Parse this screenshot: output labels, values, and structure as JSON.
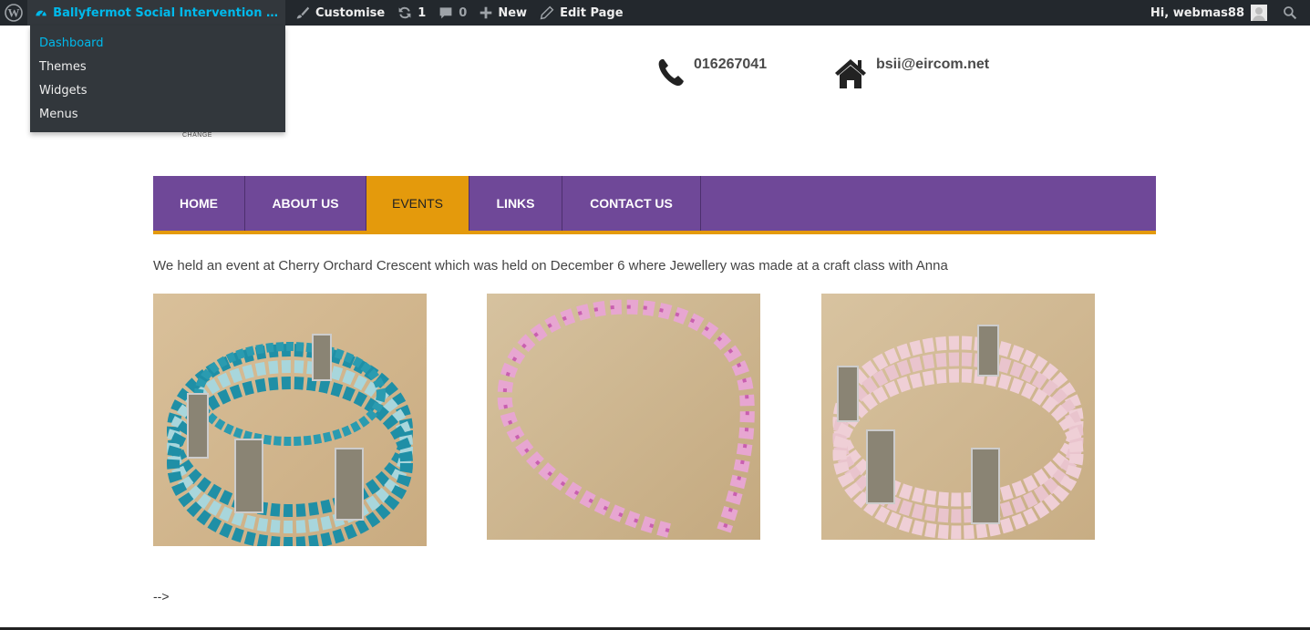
{
  "admin_bar": {
    "site_name": "Ballyfermot Social Intervention Initiati...",
    "customise_label": "Customise",
    "updates_count": "1",
    "comments_count": "0",
    "new_label": "New",
    "edit_page_label": "Edit Page",
    "greeting": "Hi, webmas88",
    "accent_color": "#00b9eb"
  },
  "site_menu": {
    "items": [
      {
        "label": "Dashboard"
      },
      {
        "label": "Themes"
      },
      {
        "label": "Widgets"
      },
      {
        "label": "Menus"
      }
    ]
  },
  "logo": {
    "text": "CHANGE"
  },
  "contact": {
    "phone": "016267041",
    "email": "bsii@eircom.net"
  },
  "nav": {
    "items": [
      {
        "label": "HOME"
      },
      {
        "label": "ABOUT US"
      },
      {
        "label": "EVENTS",
        "active": true
      },
      {
        "label": "LINKS"
      },
      {
        "label": "CONTACT US"
      }
    ],
    "color": "#6f4898",
    "active_color": "#e49a0c"
  },
  "content": {
    "event_text": "We held an event at Cherry Orchard Crescent which was held on December 6 where Jewellery was made at a craft class with Anna",
    "stray_text": "-->"
  }
}
